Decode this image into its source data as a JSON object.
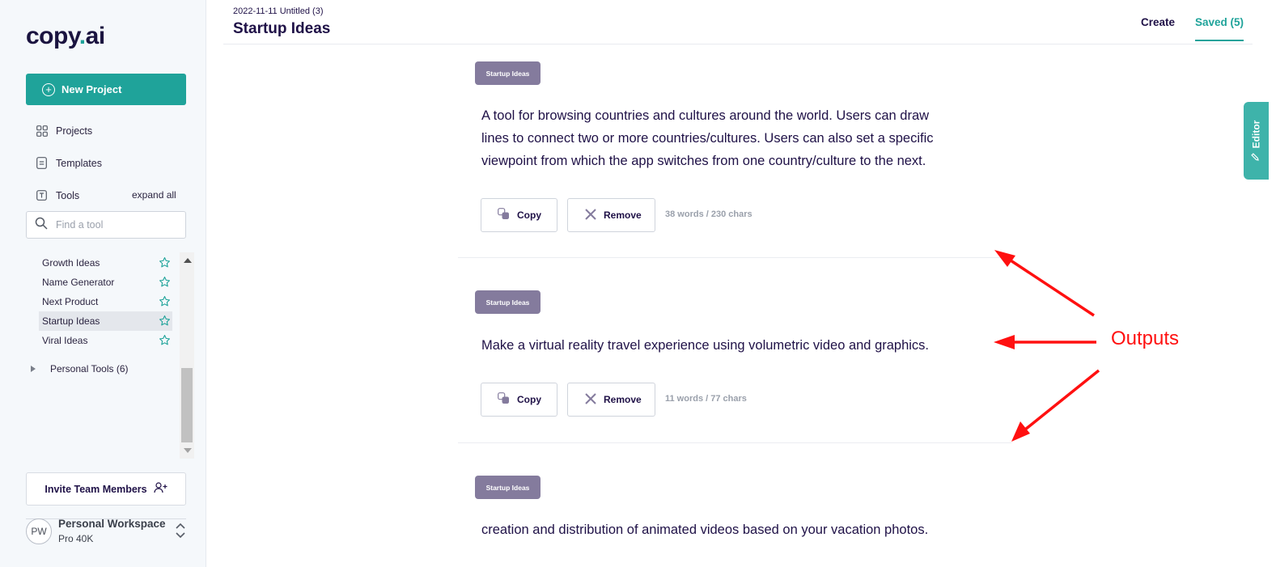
{
  "sidebar": {
    "logo": {
      "text": "copy",
      "dot": ".",
      "suffix": "ai"
    },
    "new_project": "New Project",
    "nav": [
      {
        "label": "Projects",
        "icon": "grid-icon"
      },
      {
        "label": "Templates",
        "icon": "document-icon"
      },
      {
        "label": "Tools",
        "icon": "text-box-icon"
      }
    ],
    "expand_all": "expand all",
    "search_placeholder": "Find a tool",
    "tools": [
      {
        "label": "Growth Ideas",
        "active": false
      },
      {
        "label": "Name Generator",
        "active": false
      },
      {
        "label": "Next Product",
        "active": false
      },
      {
        "label": "Startup Ideas",
        "active": true
      },
      {
        "label": "Viral Ideas",
        "active": false
      }
    ],
    "personal_tools": "Personal Tools (6)",
    "invite": "Invite Team Members",
    "workspace": {
      "initials": "PW",
      "name": "Personal Workspace",
      "plan": "Pro 40K"
    }
  },
  "header": {
    "subtitle": "2022-11-11 Untitled (3)",
    "title": "Startup Ideas",
    "tabs": {
      "create": "Create",
      "saved": "Saved (5)"
    },
    "editor_tab": "Editor"
  },
  "outputs": [
    {
      "tag": "Startup Ideas",
      "lines": [
        "A tool for browsing countries and cultures around the world. Users can draw",
        "lines to connect two or more countries/cultures. Users can also set a specific",
        "viewpoint from which the app switches from one country/culture to the next."
      ],
      "copy": "Copy",
      "remove": "Remove",
      "count": "38 words / 230 chars"
    },
    {
      "tag": "Startup Ideas",
      "lines": [
        "Make a virtual reality travel experience using volumetric video and graphics."
      ],
      "copy": "Copy",
      "remove": "Remove",
      "count": "11 words / 77 chars"
    },
    {
      "tag": "Startup Ideas",
      "lines": [
        "creation and distribution of animated videos based on your vacation photos."
      ]
    }
  ],
  "annotation": {
    "label": "Outputs",
    "color": "#ff1010"
  },
  "colors": {
    "accent": "#1fa39a",
    "tag": "#847b9d",
    "text": "#1f1147"
  }
}
